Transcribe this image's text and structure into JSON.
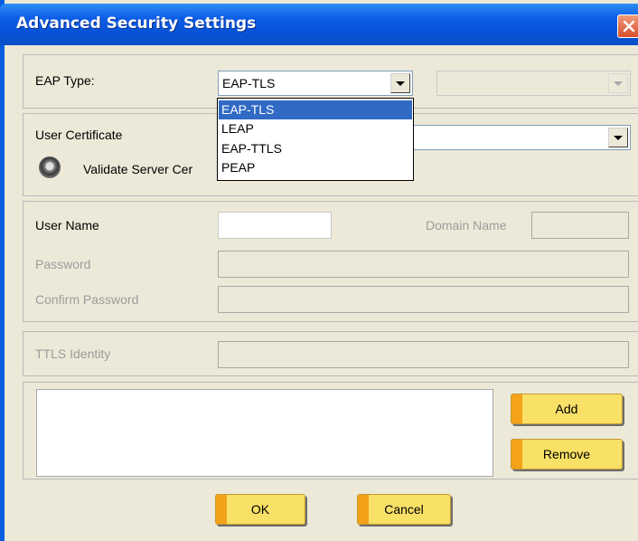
{
  "window": {
    "title": "Advanced Security Settings"
  },
  "eap": {
    "label": "EAP Type:",
    "selected": "EAP-TLS",
    "options": [
      "EAP-TLS",
      "LEAP",
      "EAP-TTLS",
      "PEAP"
    ],
    "secondary_value": ""
  },
  "certificate": {
    "label": "User Certificate",
    "validate_label": "Validate Server Cer"
  },
  "credentials": {
    "user_name_label": "User Name",
    "user_name_value": "",
    "domain_name_label": "Domain Name",
    "domain_name_value": "",
    "password_label": "Password",
    "confirm_password_label": "Confirm Password"
  },
  "ttls": {
    "identity_label": "TTLS Identity"
  },
  "buttons": {
    "add": "Add",
    "remove": "Remove",
    "ok": "OK",
    "cancel": "Cancel"
  },
  "icons": {
    "close": "close-icon",
    "dropdown": "chevron-down-icon"
  },
  "colors": {
    "title_bar": "#0d5de6",
    "dialog_bg": "#ece9d8",
    "selection": "#316ac5",
    "button": "#f9e066",
    "button_accent": "#f4a21a"
  }
}
